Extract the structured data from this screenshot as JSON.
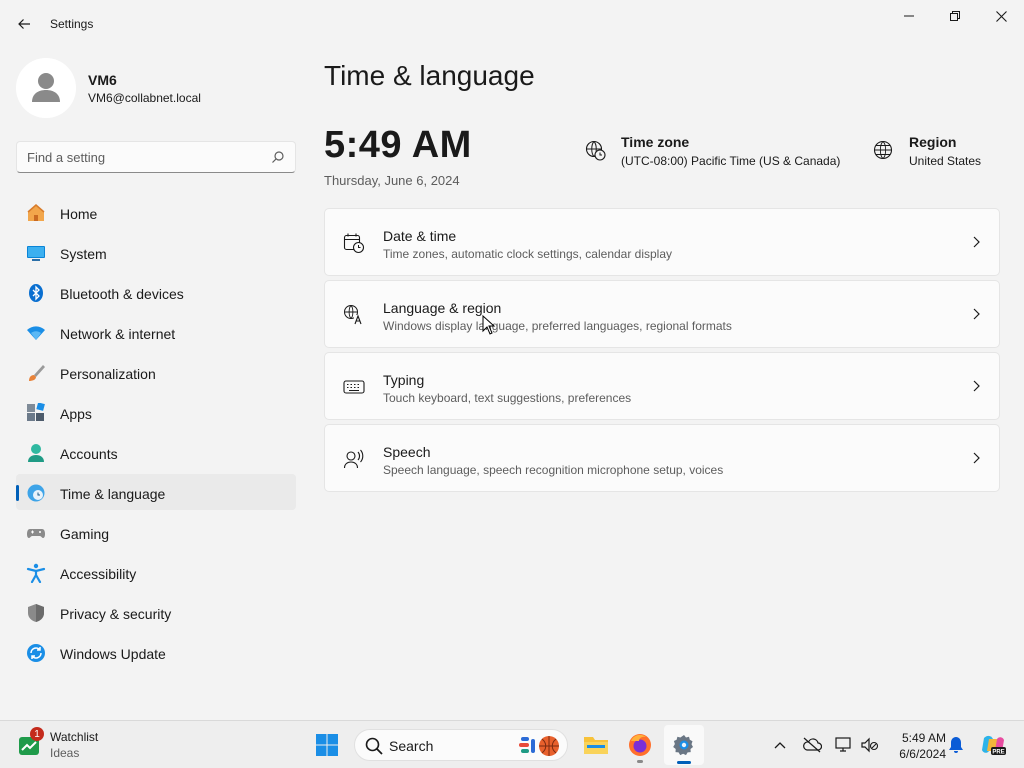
{
  "window": {
    "title": "Settings",
    "back_icon": "back-arrow-icon",
    "controls": [
      "minimize",
      "restore",
      "close"
    ]
  },
  "profile": {
    "name": "VM6",
    "email": "VM6@collabnet.local"
  },
  "search": {
    "placeholder": "Find a setting"
  },
  "sidebar": {
    "items": [
      {
        "label": "Home",
        "icon": "home-icon",
        "active": false
      },
      {
        "label": "System",
        "icon": "system-icon",
        "active": false
      },
      {
        "label": "Bluetooth & devices",
        "icon": "bluetooth-icon",
        "active": false
      },
      {
        "label": "Network & internet",
        "icon": "network-icon",
        "active": false
      },
      {
        "label": "Personalization",
        "icon": "brush-icon",
        "active": false
      },
      {
        "label": "Apps",
        "icon": "apps-icon",
        "active": false
      },
      {
        "label": "Accounts",
        "icon": "accounts-icon",
        "active": false
      },
      {
        "label": "Time & language",
        "icon": "time-language-icon",
        "active": true
      },
      {
        "label": "Gaming",
        "icon": "gaming-icon",
        "active": false
      },
      {
        "label": "Accessibility",
        "icon": "accessibility-icon",
        "active": false
      },
      {
        "label": "Privacy & security",
        "icon": "shield-icon",
        "active": false
      },
      {
        "label": "Windows Update",
        "icon": "update-icon",
        "active": false
      }
    ]
  },
  "main": {
    "title": "Time & language",
    "clock": "5:49 AM",
    "date": "Thursday, June 6, 2024",
    "timezone": {
      "label": "Time zone",
      "value": "(UTC-08:00) Pacific Time (US & Canada)"
    },
    "region": {
      "label": "Region",
      "value": "United States"
    },
    "cards": [
      {
        "title": "Date & time",
        "subtitle": "Time zones, automatic clock settings, calendar display",
        "icon": "calendar-clock-icon"
      },
      {
        "title": "Language & region",
        "subtitle": "Windows display language, preferred languages, regional formats",
        "icon": "language-icon"
      },
      {
        "title": "Typing",
        "subtitle": "Touch keyboard, text suggestions, preferences",
        "icon": "keyboard-icon"
      },
      {
        "title": "Speech",
        "subtitle": "Speech language, speech recognition microphone setup, voices",
        "icon": "speech-icon"
      }
    ]
  },
  "taskbar": {
    "widget": {
      "title": "Watchlist",
      "subtitle": "Ideas",
      "badge": "1"
    },
    "search_label": "Search",
    "time": "5:49 AM",
    "date": "6/6/2024",
    "copilot_badge": "PRE"
  },
  "colors": {
    "accent": "#005fb8",
    "background": "#f3f3f3",
    "card": "#fbfbfb"
  }
}
